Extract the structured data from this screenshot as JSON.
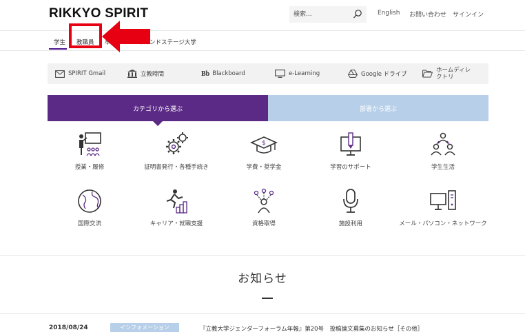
{
  "header": {
    "logo": "RIKKYO SPIRIT",
    "search_placeholder": "検索...",
    "links": [
      "English",
      "お問い合わせ",
      "サインイン"
    ]
  },
  "tabs": [
    "学生",
    "教職員",
    "卒",
    "セカンドステージ大学"
  ],
  "services": [
    {
      "label": "SPIRIT Gmail",
      "icon": "mail-icon"
    },
    {
      "label": "立教時間",
      "icon": "building-icon"
    },
    {
      "label": "Blackboard",
      "icon": "blackboard-icon",
      "icon_text": "Bb"
    },
    {
      "label": "e-Learning",
      "icon": "monitor-icon"
    },
    {
      "label": "Google ドライブ",
      "icon": "google-drive-icon"
    },
    {
      "label": "ホームディレクトリ",
      "icon": "folder-icon"
    }
  ],
  "category_tabs": {
    "active": "カテゴリから選ぶ",
    "inactive": "部署から選ぶ"
  },
  "categories": [
    {
      "label": "授業・履修",
      "icon": "classroom-icon"
    },
    {
      "label": "証明書発行・各種手続き",
      "icon": "gears-icon"
    },
    {
      "label": "学費・奨学金",
      "icon": "graduation-cap-icon"
    },
    {
      "label": "学習のサポート",
      "icon": "monitor-pen-icon"
    },
    {
      "label": "学生生活",
      "icon": "students-icon"
    },
    {
      "label": "国際交流",
      "icon": "globe-icon"
    },
    {
      "label": "キャリア・就職支援",
      "icon": "career-runner-icon"
    },
    {
      "label": "資格取得",
      "icon": "qualification-icon"
    },
    {
      "label": "施設利用",
      "icon": "microphone-icon"
    },
    {
      "label": "メール・パソコン・ネットワーク",
      "icon": "computer-icon"
    }
  ],
  "news": {
    "title": "お知らせ",
    "items": [
      {
        "date": "2018/08/24",
        "badge": "インフォメーション",
        "text": "『立教大学ジェンダーフォーラム年報』第20号　投稿論文募集のお知らせ［その他］"
      }
    ]
  },
  "colors": {
    "accent_purple": "#5b2a86",
    "light_blue": "#b7cfe8",
    "highlight_red": "#e60012"
  }
}
